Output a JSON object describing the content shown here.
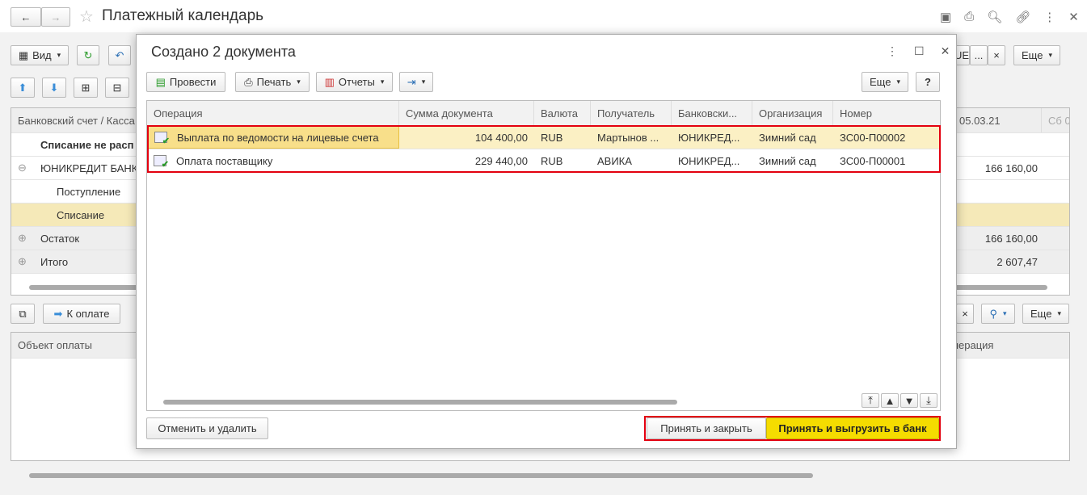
{
  "window": {
    "title": "Платежный календарь"
  },
  "main_toolbar": {
    "view_label": "Вид",
    "more_label": "Еще",
    "filter_value": "UE",
    "filter_dots": "..."
  },
  "main_table": {
    "header": "Банковский счет / Касса",
    "date_col": "05.03.21",
    "date_col2": "Сб 0",
    "rows": [
      {
        "label": "Списание не расп",
        "value": ""
      },
      {
        "label": "ЮНИКРЕДИТ БАНК",
        "value": "166 160,00"
      },
      {
        "label": "Поступление",
        "value": ""
      },
      {
        "label": "Списание",
        "value": ""
      },
      {
        "label": "Остаток",
        "value": "166 160,00"
      },
      {
        "label": "Итого",
        "value": "2 607,47"
      }
    ]
  },
  "lower_toolbar": {
    "to_pay_label": "К оплате",
    "more_label": "Еще"
  },
  "lower_table": {
    "col1": "Объект оплаты",
    "col_last": "перация"
  },
  "dialog": {
    "title": "Создано 2 документа",
    "toolbar": {
      "post": "Провести",
      "print": "Печать",
      "reports": "Отчеты",
      "more": "Еще",
      "help": "?"
    },
    "columns": [
      "Операция",
      "Сумма документа",
      "Валюта",
      "Получатель",
      "Банковски...",
      "Организация",
      "Номер"
    ],
    "rows": [
      [
        "Выплата по ведомости на лицевые счета",
        "104 400,00",
        "RUB",
        "Мартынов ...",
        "ЮНИКРЕД...",
        "Зимний сад",
        "ЗС00-П00002"
      ],
      [
        "Оплата поставщику",
        "229 440,00",
        "RUB",
        "АВИКА",
        "ЮНИКРЕД...",
        "Зимний сад",
        "ЗС00-П00001"
      ]
    ],
    "footer": {
      "cancel": "Отменить и удалить",
      "accept_close": "Принять и закрыть",
      "accept_upload": "Принять и выгрузить в банк"
    }
  },
  "colors": {
    "highlight": "#e3000f",
    "selected_row": "#f5e9b8",
    "primary_button": "#f5dc00"
  }
}
